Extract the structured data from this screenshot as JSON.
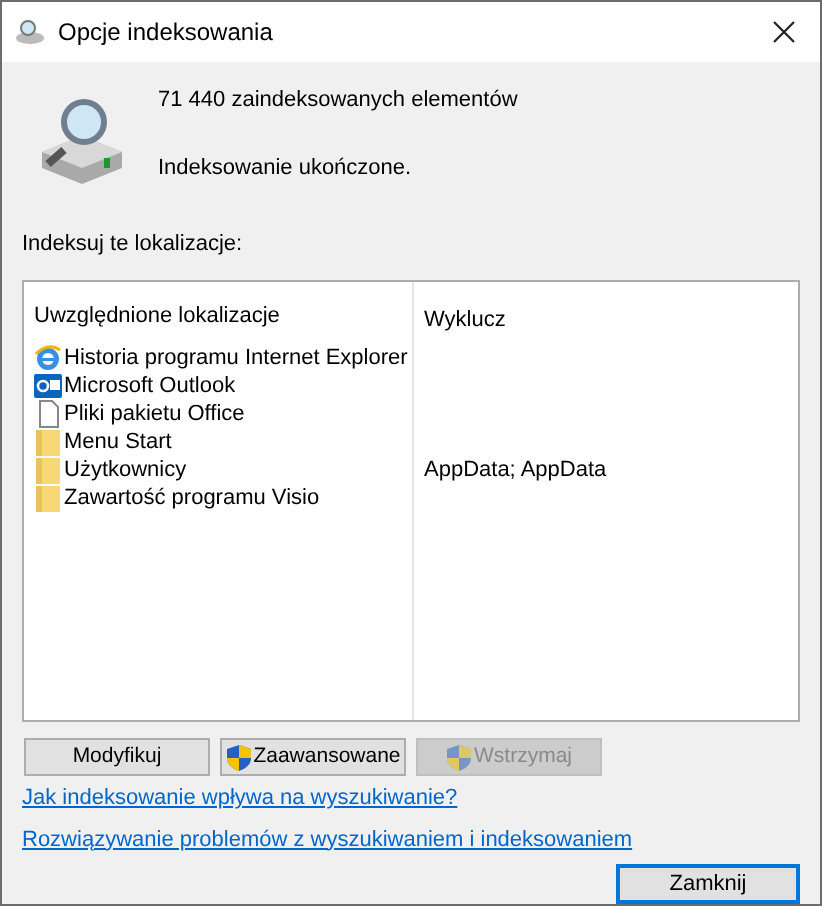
{
  "window": {
    "title": "Opcje indeksowania"
  },
  "status": {
    "count": "71 440 zaindeksowanych elementów",
    "message": "Indeksowanie ukończone."
  },
  "locations_label": "Indeksuj te lokalizacje:",
  "table": {
    "columns": [
      "Uwzględnione lokalizacje",
      "Wyklucz"
    ],
    "rows": [
      {
        "kind": "browser",
        "name": "Historia programu Internet Explorer"
      },
      {
        "kind": "mail",
        "name": "Microsoft Outlook"
      },
      {
        "kind": "file",
        "name": "Pliki pakietu Office"
      },
      {
        "kind": "folder",
        "name": "Menu Start"
      },
      {
        "kind": "folder",
        "name": "Użytkownicy",
        "exclude": "AppData; AppData"
      },
      {
        "kind": "folder",
        "name": "Zawartość programu Visio"
      }
    ]
  },
  "buttons": [
    {
      "label": "Modyfikuj",
      "shield": false,
      "disabled": false
    },
    {
      "label": "Zaawansowane",
      "shield": true,
      "disabled": false
    },
    {
      "label": "Wstrzymaj",
      "shield": true,
      "disabled": true
    }
  ],
  "links": [
    "Jak indeksowanie wpływa na wyszukiwanie?",
    "Rozwiązywanie problemów z wyszukiwaniem i indeksowaniem"
  ],
  "close_button": "Zamknij"
}
